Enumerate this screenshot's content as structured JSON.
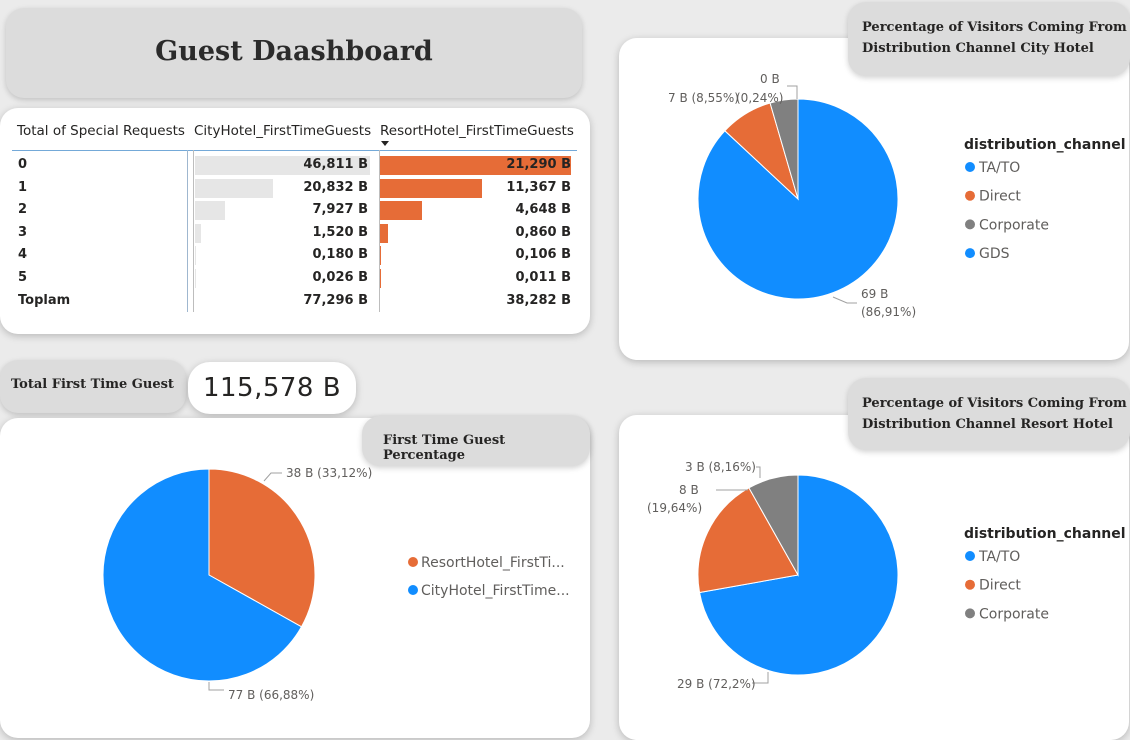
{
  "dashboard": {
    "title": "Guest Daashboard"
  },
  "table": {
    "headers": [
      "Total of Special Requests",
      "CityHotel_FirstTimeGuests",
      "ResortHotel_FirstTimeGuests"
    ],
    "sort_indicator": "sort-descending-icon",
    "rows": [
      {
        "label": "0",
        "city": "46,811 B",
        "resort": "21,290 B",
        "city_value": 46.811,
        "resort_value": 21.29
      },
      {
        "label": "1",
        "city": "20,832 B",
        "resort": "11,367 B",
        "city_value": 20.832,
        "resort_value": 11.367
      },
      {
        "label": "2",
        "city": "7,927 B",
        "resort": "4,648 B",
        "city_value": 7.927,
        "resort_value": 4.648
      },
      {
        "label": "3",
        "city": "1,520 B",
        "resort": "0,860 B",
        "city_value": 1.52,
        "resort_value": 0.86
      },
      {
        "label": "4",
        "city": "0,180 B",
        "resort": "0,106 B",
        "city_value": 0.18,
        "resort_value": 0.106
      },
      {
        "label": "5",
        "city": "0,026 B",
        "resort": "0,011 B",
        "city_value": 0.026,
        "resort_value": 0.011
      }
    ],
    "total": {
      "label": "Toplam",
      "city": "77,296 B",
      "resort": "38,282 B"
    },
    "colors": {
      "city_bar": "#e6e6e6",
      "resort_bar": "#e66c37"
    }
  },
  "kpi": {
    "label": "Total First Time Guest",
    "value": "115,578 B"
  },
  "first_time_pie": {
    "title": "First Time Guest Percentage",
    "legend": [
      "ResortHotel_FirstTi...",
      "CityHotel_FirstTime..."
    ],
    "labels": [
      "38 B (33,12%)",
      "77 B (66,88%)"
    ]
  },
  "city_pie": {
    "title": "Percentage of Visitors Coming From Distribution Channel City Hotel",
    "title_lines": [
      "Percentage of Visitors Coming From",
      "Distribution Channel City Hotel"
    ],
    "legend_title": "distribution_channel",
    "legend": [
      "TA/TO",
      "Direct",
      "Corporate",
      "GDS"
    ],
    "labels": {
      "corporate": "0 B",
      "direct": "7 B (8,55%)",
      "gds": "(0,24%)",
      "tato_1": "69 B",
      "tato_2": "(86,91%)"
    }
  },
  "resort_pie": {
    "title_lines": [
      "Percentage of Visitors Coming From",
      "Distribution Channel Resort Hotel"
    ],
    "legend_title": "distribution_channel",
    "legend": [
      "TA/TO",
      "Direct",
      "Corporate"
    ],
    "labels": {
      "corporate": "3 B (8,16%)",
      "direct_1": "8 B",
      "direct_2": "(19,64%)",
      "tato": "29 B (72,2%)"
    }
  },
  "chart_data": [
    {
      "type": "pie",
      "title": "First Time Guest Percentage",
      "categories": [
        "ResortHotel_FirstTimeGuests",
        "CityHotel_FirstTimeGuests"
      ],
      "values": [
        38.282,
        77.296
      ],
      "percentages": [
        33.12,
        66.88
      ],
      "colors": [
        "#e66c37",
        "#118dff"
      ],
      "legend": "right"
    },
    {
      "type": "pie",
      "title": "Percentage of Visitors Coming From Distribution Channel City Hotel",
      "categories": [
        "TA/TO",
        "Direct",
        "Corporate",
        "GDS"
      ],
      "percentages": [
        86.91,
        8.55,
        0,
        0.24
      ],
      "colors": [
        "#118dff",
        "#e66c37",
        "#808080",
        "#118dff"
      ],
      "legend": "right"
    },
    {
      "type": "pie",
      "title": "Percentage of Visitors Coming From Distribution Channel Resort Hotel",
      "categories": [
        "TA/TO",
        "Direct",
        "Corporate"
      ],
      "values": [
        29,
        8,
        3
      ],
      "percentages": [
        72.2,
        19.64,
        8.16
      ],
      "colors": [
        "#118dff",
        "#e66c37",
        "#808080"
      ],
      "legend": "right"
    },
    {
      "type": "table",
      "columns": [
        "Total of Special Requests",
        "CityHotel_FirstTimeGuests",
        "ResortHotel_FirstTimeGuests"
      ],
      "rows": [
        [
          "0",
          46.811,
          21.29
        ],
        [
          "1",
          20.832,
          11.367
        ],
        [
          "2",
          7.927,
          4.648
        ],
        [
          "3",
          1.52,
          0.86
        ],
        [
          "4",
          0.18,
          0.106
        ],
        [
          "5",
          0.026,
          0.011
        ],
        [
          "Toplam",
          77.296,
          38.282
        ]
      ]
    }
  ]
}
